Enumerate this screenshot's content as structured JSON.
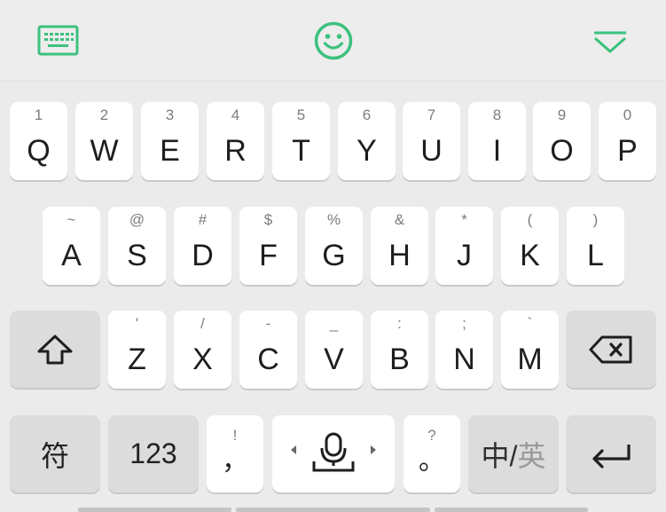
{
  "toolbar": {
    "keyboard_icon": "keyboard-icon",
    "emoji_icon": "smiley-icon",
    "collapse_icon": "chevron-down-icon",
    "accent": "#3cc17f"
  },
  "row1": [
    {
      "sub": "1",
      "main": "Q"
    },
    {
      "sub": "2",
      "main": "W"
    },
    {
      "sub": "3",
      "main": "E"
    },
    {
      "sub": "4",
      "main": "R"
    },
    {
      "sub": "5",
      "main": "T"
    },
    {
      "sub": "6",
      "main": "Y"
    },
    {
      "sub": "7",
      "main": "U"
    },
    {
      "sub": "8",
      "main": "I"
    },
    {
      "sub": "9",
      "main": "O"
    },
    {
      "sub": "0",
      "main": "P"
    }
  ],
  "row2": [
    {
      "sub": "~",
      "main": "A"
    },
    {
      "sub": "@",
      "main": "S"
    },
    {
      "sub": "#",
      "main": "D"
    },
    {
      "sub": "$",
      "main": "F"
    },
    {
      "sub": "%",
      "main": "G"
    },
    {
      "sub": "&",
      "main": "H"
    },
    {
      "sub": "*",
      "main": "J"
    },
    {
      "sub": "(",
      "main": "K"
    },
    {
      "sub": ")",
      "main": "L"
    }
  ],
  "row3": [
    {
      "sub": "'",
      "main": "Z"
    },
    {
      "sub": "/",
      "main": "X"
    },
    {
      "sub": "-",
      "main": "C"
    },
    {
      "sub": "_",
      "main": "V"
    },
    {
      "sub": ":",
      "main": "B"
    },
    {
      "sub": ";",
      "main": "N"
    },
    {
      "sub": "`",
      "main": "M"
    }
  ],
  "row4": {
    "symbols": "符",
    "numbers": "123",
    "comma_sub": "!",
    "comma": "，",
    "period_sub": "?",
    "period": "。",
    "lang_a": "中/",
    "lang_b": "英"
  }
}
